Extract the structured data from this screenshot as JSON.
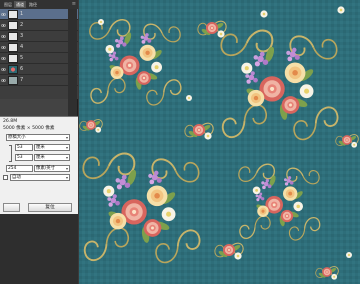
{
  "tabs": [
    "图层",
    "通道",
    "路径"
  ],
  "layers": [
    {
      "label": "1",
      "selected": true
    },
    {
      "label": "2"
    },
    {
      "label": "3"
    },
    {
      "label": "4"
    },
    {
      "label": "5"
    },
    {
      "label": "6"
    },
    {
      "label": "7"
    }
  ],
  "dialog": {
    "size_label": "26.8M",
    "dims_label": "5000 像素 × 5000 像素",
    "fit_label": "原稿大小",
    "width_value": "53",
    "height_value": "53",
    "resolution_value": "254",
    "unit_width": "厘米",
    "unit_height": "厘米",
    "unit_resolution": "像素/英寸",
    "resample_label": "自动",
    "cancel_label": "复位",
    "ok_label": ""
  }
}
